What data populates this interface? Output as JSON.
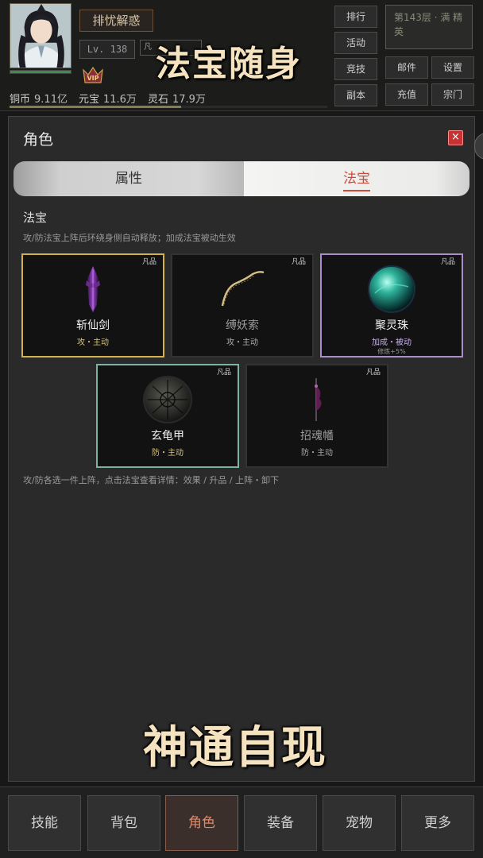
{
  "header": {
    "player_name": "排忧解惑",
    "level": "Lv. 138",
    "rank_label": "凡",
    "vip_label": "VIP",
    "currencies": [
      {
        "name": "铜币",
        "value": "9.11亿"
      },
      {
        "name": "元宝",
        "value": "11.6万"
      },
      {
        "name": "灵石",
        "value": "17.9万"
      }
    ],
    "floor_info": "第143层 · 满 精英",
    "menu": {
      "ranking": "排行",
      "events": "活动",
      "arena": "竞技",
      "dungeon": "副本",
      "mail": "邮件",
      "settings": "设置",
      "recharge": "充值",
      "sect": "宗门"
    }
  },
  "banners": {
    "top": "法宝随身",
    "bottom": "神通自现"
  },
  "panel": {
    "title": "角色",
    "close_label": "×",
    "tabs": [
      {
        "label": "属性",
        "active": false
      },
      {
        "label": "法宝",
        "active": true
      }
    ],
    "section_title": "法宝",
    "section_desc": "攻/防法宝上阵后环绕身侧自动释放；加成法宝被动生效",
    "footer_hint": "攻/防各选一件上阵，点击法宝查看详情：效果 / 升品 / 上阵・卸下",
    "treasures": [
      {
        "name": "斩仙剑",
        "grade": "凡品",
        "type": "攻・主动",
        "selected": true,
        "icon": "purple-sword-icon"
      },
      {
        "name": "缚妖索",
        "grade": "凡品",
        "type": "攻・主动",
        "selected": false,
        "icon": "golden-rope-icon"
      },
      {
        "name": "聚灵珠",
        "grade": "凡品",
        "type": "加成・被动",
        "bonus": "修炼+5%",
        "selected": true,
        "icon": "spirit-orb-icon"
      },
      {
        "name": "玄龟甲",
        "grade": "凡品",
        "type": "防・主动",
        "selected": true,
        "icon": "turtle-shell-icon"
      },
      {
        "name": "招魂幡",
        "grade": "凡品",
        "type": "防・主动",
        "selected": false,
        "icon": "soul-banner-icon"
      }
    ]
  },
  "progress": {
    "hp_fraction": 1.0,
    "exp_fraction": 0.54
  },
  "colors": {
    "tab_active_text": "#cc4a3a",
    "gold_border": "#d4b24b",
    "purple_border": "#a98ec9",
    "green_border": "#7cb3a2",
    "close_red": "#c93232"
  },
  "bottom_nav": [
    {
      "label": "技能",
      "active": false
    },
    {
      "label": "背包",
      "active": false
    },
    {
      "label": "角色",
      "active": true
    },
    {
      "label": "装备",
      "active": false
    },
    {
      "label": "宠物",
      "active": false
    },
    {
      "label": "更多",
      "active": false
    }
  ]
}
